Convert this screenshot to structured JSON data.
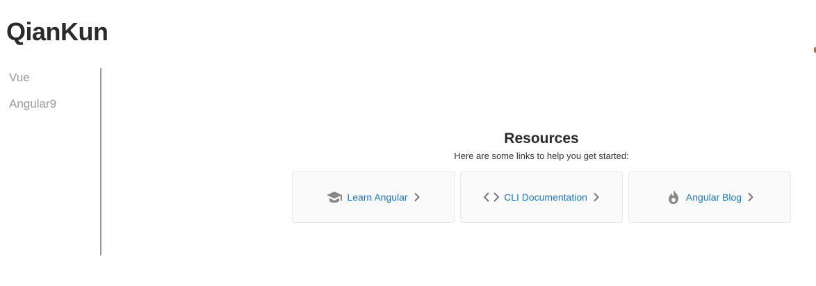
{
  "header": {
    "title": "QianKun"
  },
  "sidebar": {
    "items": [
      {
        "label": "Vue"
      },
      {
        "label": "Angular9"
      }
    ]
  },
  "resources": {
    "title": "Resources",
    "subtitle": "Here are some links to help you get started:",
    "cards": [
      {
        "label": "Learn Angular",
        "icon": "graduation-cap-icon"
      },
      {
        "label": "CLI Documentation",
        "icon": "code-icon"
      },
      {
        "label": "Angular Blog",
        "icon": "flame-icon"
      }
    ]
  },
  "colors": {
    "link": "#1976d2",
    "sidebar_text": "#9a9a9a",
    "card_bg": "#fafafa",
    "icon": "#888888"
  }
}
